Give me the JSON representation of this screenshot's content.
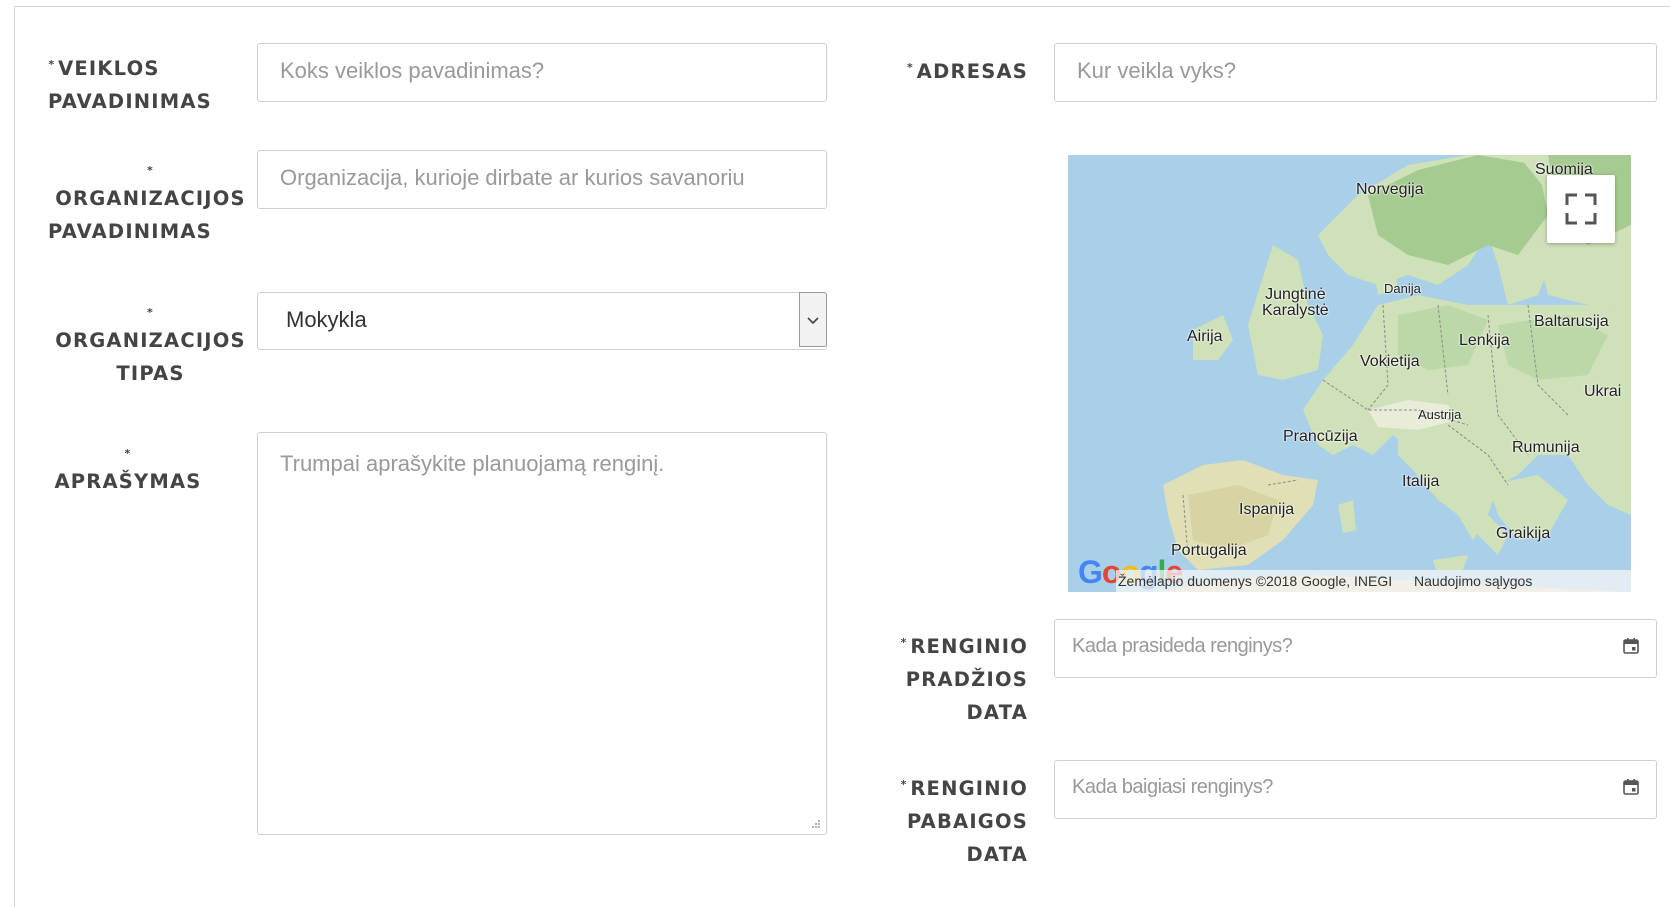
{
  "form": {
    "activity_name": {
      "required_mark": "*",
      "label_line1": "VEIKLOS",
      "label_line2": "PAVADINIMAS",
      "placeholder": "Koks veiklos pavadinimas?"
    },
    "org_name": {
      "required_mark": "*",
      "label_line1": "ORGANIZACIJOS",
      "label_line2": "PAVADINIMAS",
      "placeholder": "Organizacija, kurioje dirbate ar kurios savanoriu"
    },
    "org_type": {
      "required_mark": "*",
      "label_line1": "ORGANIZACIJOS",
      "label_line2": "TIPAS",
      "selected": "Mokykla"
    },
    "description": {
      "required_mark": "*",
      "label": "APRAŠYMAS",
      "placeholder": "Trumpai aprašykite planuojamą renginį."
    },
    "address": {
      "required_mark": "*",
      "label": "ADRESAS",
      "placeholder": "Kur veikla vyks?"
    },
    "start_date": {
      "required_mark": "*",
      "label_line1": "RENGINIO",
      "label_line2": "PRADŽIOS",
      "label_line3": "DATA",
      "placeholder": "Kada prasideda renginys?"
    },
    "end_date": {
      "required_mark": "*",
      "label_line1": "RENGINIO",
      "label_line2": "PABAIGOS",
      "label_line3": "DATA",
      "placeholder": "Kada baigiasi renginys?"
    }
  },
  "map": {
    "countries": {
      "suomija": "Suomija",
      "norvegija": "Norvegija",
      "danija": "Danija",
      "jungtine1": "Jungtinė",
      "jungtine2": "Karalystė",
      "airija": "Airija",
      "baltarusija": "Baltarusija",
      "lenkija": "Lenkija",
      "vokietija": "Vokietija",
      "ukraina": "Ukrai",
      "austrija": "Austrija",
      "prancuzija": "Prancūzija",
      "rumunija": "Rumunija",
      "italija": "Italija",
      "ispanija": "Ispanija",
      "graikija": "Graikija",
      "portugalija": "Portugalija"
    },
    "logo": "Google",
    "attribution": "Žemėlapio duomenys ©2018 Google, INEGI",
    "terms": "Naudojimo sąlygos",
    "colors": {
      "water": "#a9cfe9",
      "land": "#cfe1b9",
      "forest": "#9fc68f",
      "border": "#8a8a8a"
    }
  }
}
